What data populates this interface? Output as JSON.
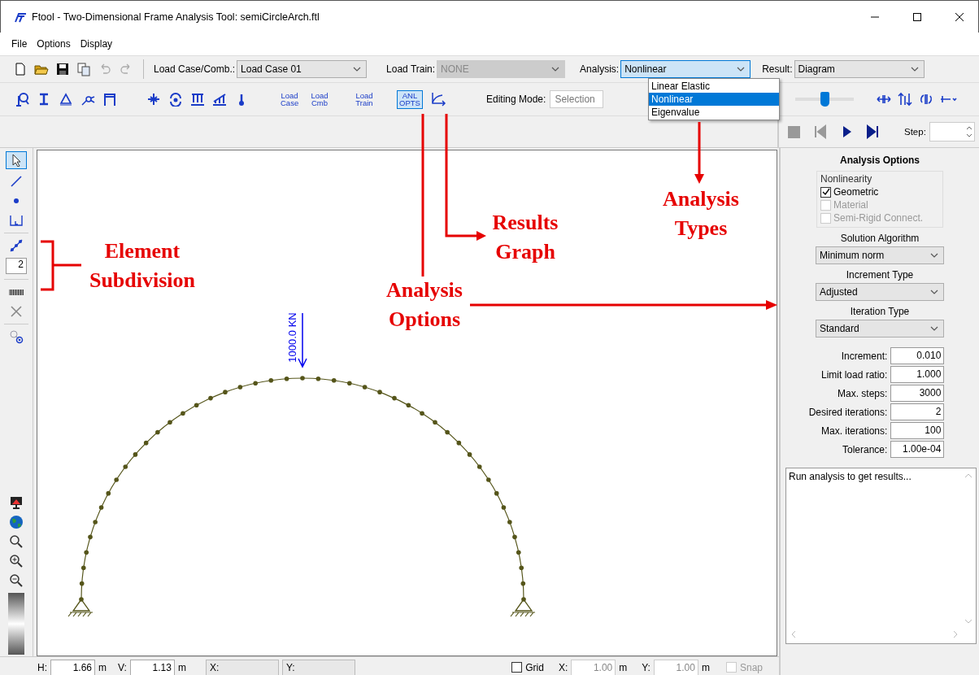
{
  "window": {
    "title": "Ftool - Two-Dimensional Frame Analysis Tool: semiCircleArch.ftl"
  },
  "menu": [
    "File",
    "Options",
    "Display"
  ],
  "toolbar": {
    "load_case": {
      "label": "Load Case/Comb.:",
      "value": "Load Case 01"
    },
    "load_train": {
      "label": "Load Train:",
      "value": "NONE",
      "disabled": true
    },
    "analysis": {
      "label": "Analysis:",
      "value": "Nonlinear",
      "expanded": true,
      "options": [
        {
          "label": "Linear Elastic",
          "selected": false
        },
        {
          "label": "Nonlinear",
          "selected": true
        },
        {
          "label": "Eigenvalue",
          "selected": false
        }
      ]
    },
    "result": {
      "label": "Result:",
      "value": "Diagram"
    }
  },
  "text_tools": [
    {
      "label": "Load Case",
      "selected": false
    },
    {
      "label": "Load Cmb",
      "selected": false
    },
    {
      "label": "Load Train",
      "selected": false
    },
    {
      "label": "ANL OPTS",
      "selected": true
    }
  ],
  "editing_mode": {
    "label": "Editing Mode:",
    "value": "Selection"
  },
  "scale_slider": {
    "level": 0.5
  },
  "step": {
    "label": "Step:"
  },
  "side_toolbar": {
    "select_active": true,
    "subdivisions": "2"
  },
  "canvas": {
    "load_label": "1000.0 KN"
  },
  "panel": {
    "title": "Analysis Options",
    "nonlinearity": {
      "title": "Nonlinearity",
      "options": [
        {
          "label": "Geometric",
          "checked": true,
          "disabled": false
        },
        {
          "label": "Material",
          "checked": false,
          "disabled": true
        },
        {
          "label": "Semi-Rigid Connect.",
          "checked": false,
          "disabled": true
        }
      ]
    },
    "selects": [
      {
        "label": "Solution Algorithm",
        "value": "Minimum norm"
      },
      {
        "label": "Increment Type",
        "value": "Adjusted"
      },
      {
        "label": "Iteration Type",
        "value": "Standard"
      }
    ],
    "params": [
      {
        "label": "Increment:",
        "value": "0.010"
      },
      {
        "label": "Limit load ratio:",
        "value": "1.000"
      },
      {
        "label": "Max. steps:",
        "value": "3000"
      },
      {
        "label": "Desired iterations:",
        "value": "2"
      },
      {
        "label": "Max. iterations:",
        "value": "100"
      },
      {
        "label": "Tolerance:",
        "value": "1.00e-04"
      }
    ]
  },
  "output": {
    "text": "Run analysis to get results..."
  },
  "status_bar": {
    "h": {
      "label": "H:",
      "value": "1.66",
      "unit": "m"
    },
    "v": {
      "label": "V:",
      "value": "1.13",
      "unit": "m"
    },
    "x_label": "X:",
    "y_label": "Y:",
    "grid": {
      "label": "Grid",
      "checked": false
    },
    "grid_x": {
      "label": "X:",
      "value": "1.00",
      "unit": "m"
    },
    "grid_y": {
      "label": "Y:",
      "value": "1.00",
      "unit": "m"
    },
    "snap": {
      "label": "Snap",
      "checked": false,
      "disabled": true
    }
  },
  "annotations": [
    {
      "text": "Element Subdivision"
    },
    {
      "text": "Results Graph"
    },
    {
      "text": "Analysis Types"
    },
    {
      "text": "Analysis Options"
    }
  ]
}
